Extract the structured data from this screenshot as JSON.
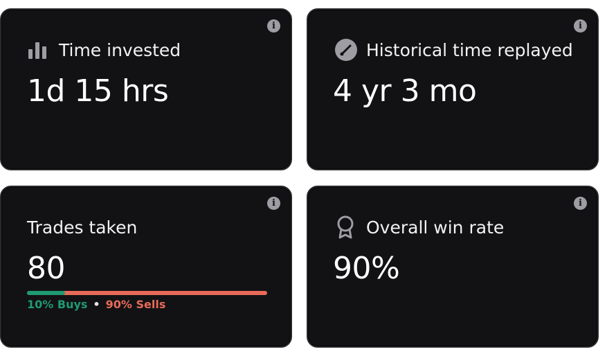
{
  "cards": [
    {
      "title": "Time invested",
      "value": "1d 15 hrs",
      "icon": "bar-chart-icon",
      "info_icon": "info-icon"
    },
    {
      "title": "Historical time replayed",
      "value": "4 yr 3 mo",
      "icon": "gauge-icon",
      "info_icon": "info-icon"
    },
    {
      "title": "Trades taken",
      "value": "80",
      "info_icon": "info-icon",
      "split": {
        "buy_fraction": 0.1,
        "buys_label": "10% Buys",
        "separator": "•",
        "sells_label": "90% Sells"
      }
    },
    {
      "title": "Overall win rate",
      "value": "90%",
      "icon": "award-ribbon-icon",
      "info_icon": "info-icon"
    }
  ],
  "colors": {
    "card_background": "#121214",
    "buy": "#1f9a73",
    "sell": "#e86a58",
    "icon": "#9d9da3"
  }
}
